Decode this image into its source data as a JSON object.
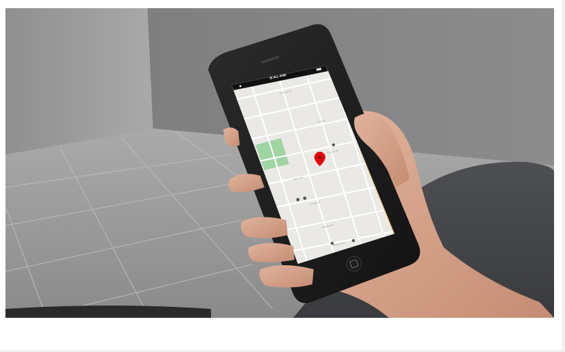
{
  "phone": {
    "status_time": "9:41 AM"
  },
  "map": {
    "pin_color": "#e00000",
    "park_color": "#9fd4a3",
    "street_labels": [
      "S Benton St",
      "N Flo St",
      "Sarvis St",
      "W Main St",
      "Warwick St",
      "S Cross St",
      "Stevens Ave"
    ]
  },
  "icons": [
    "location-pin-icon",
    "wifi-icon",
    "battery-icon",
    "home-button-icon"
  ]
}
